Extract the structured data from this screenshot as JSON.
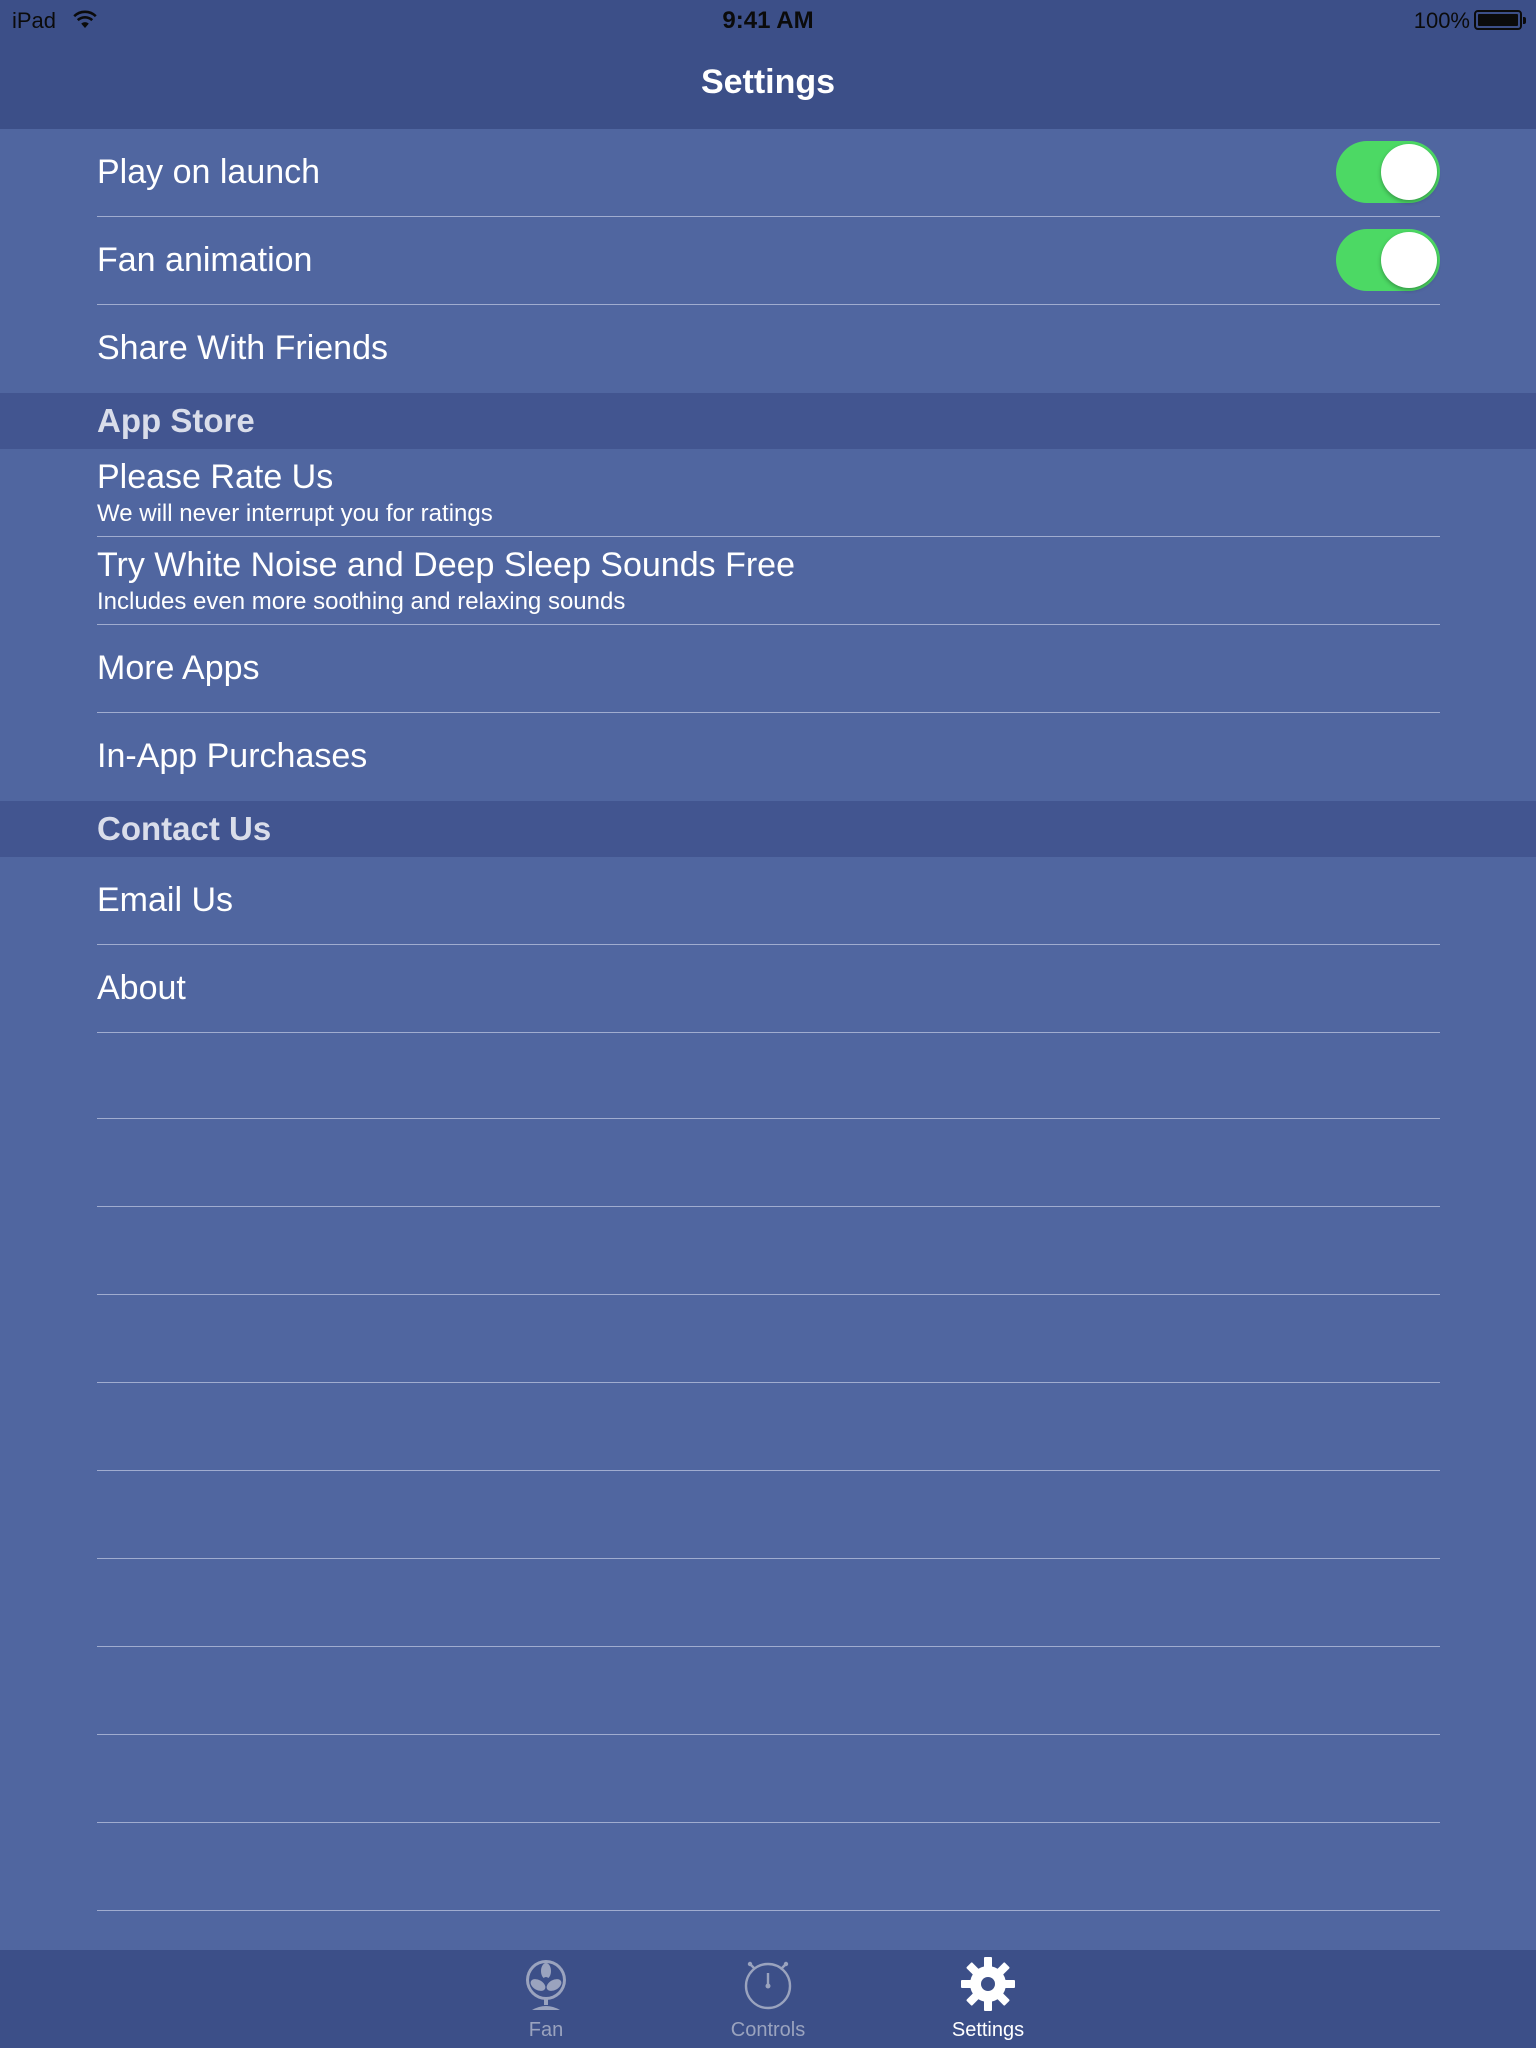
{
  "status_bar": {
    "device": "iPad",
    "time": "9:41 AM",
    "battery": "100%"
  },
  "nav": {
    "title": "Settings"
  },
  "general": {
    "play_on_launch": {
      "label": "Play on launch",
      "on": true
    },
    "fan_animation": {
      "label": "Fan animation",
      "on": true
    },
    "share": {
      "label": "Share With Friends"
    }
  },
  "app_store": {
    "header": "App Store",
    "rate": {
      "title": "Please Rate Us",
      "subtitle": "We will never interrupt you for ratings"
    },
    "white_noise": {
      "title": "Try White Noise and Deep Sleep Sounds Free",
      "subtitle": "Includes even more soothing and relaxing sounds"
    },
    "more_apps": {
      "label": "More Apps"
    },
    "purchases": {
      "label": "In-App Purchases"
    }
  },
  "contact": {
    "header": "Contact Us",
    "email": {
      "label": "Email Us"
    },
    "about": {
      "label": "About"
    }
  },
  "tabbar": {
    "tabs": [
      {
        "label": "Fan",
        "icon": "fan-icon",
        "active": false
      },
      {
        "label": "Controls",
        "icon": "timer-icon",
        "active": false
      },
      {
        "label": "Settings",
        "icon": "gear-icon",
        "active": true
      }
    ]
  },
  "colors": {
    "background": "#5066a0",
    "bar": "#3c4f88",
    "section_header": "#425590",
    "toggle_on": "#4cd964",
    "inactive_tab": "#9aa3be"
  }
}
